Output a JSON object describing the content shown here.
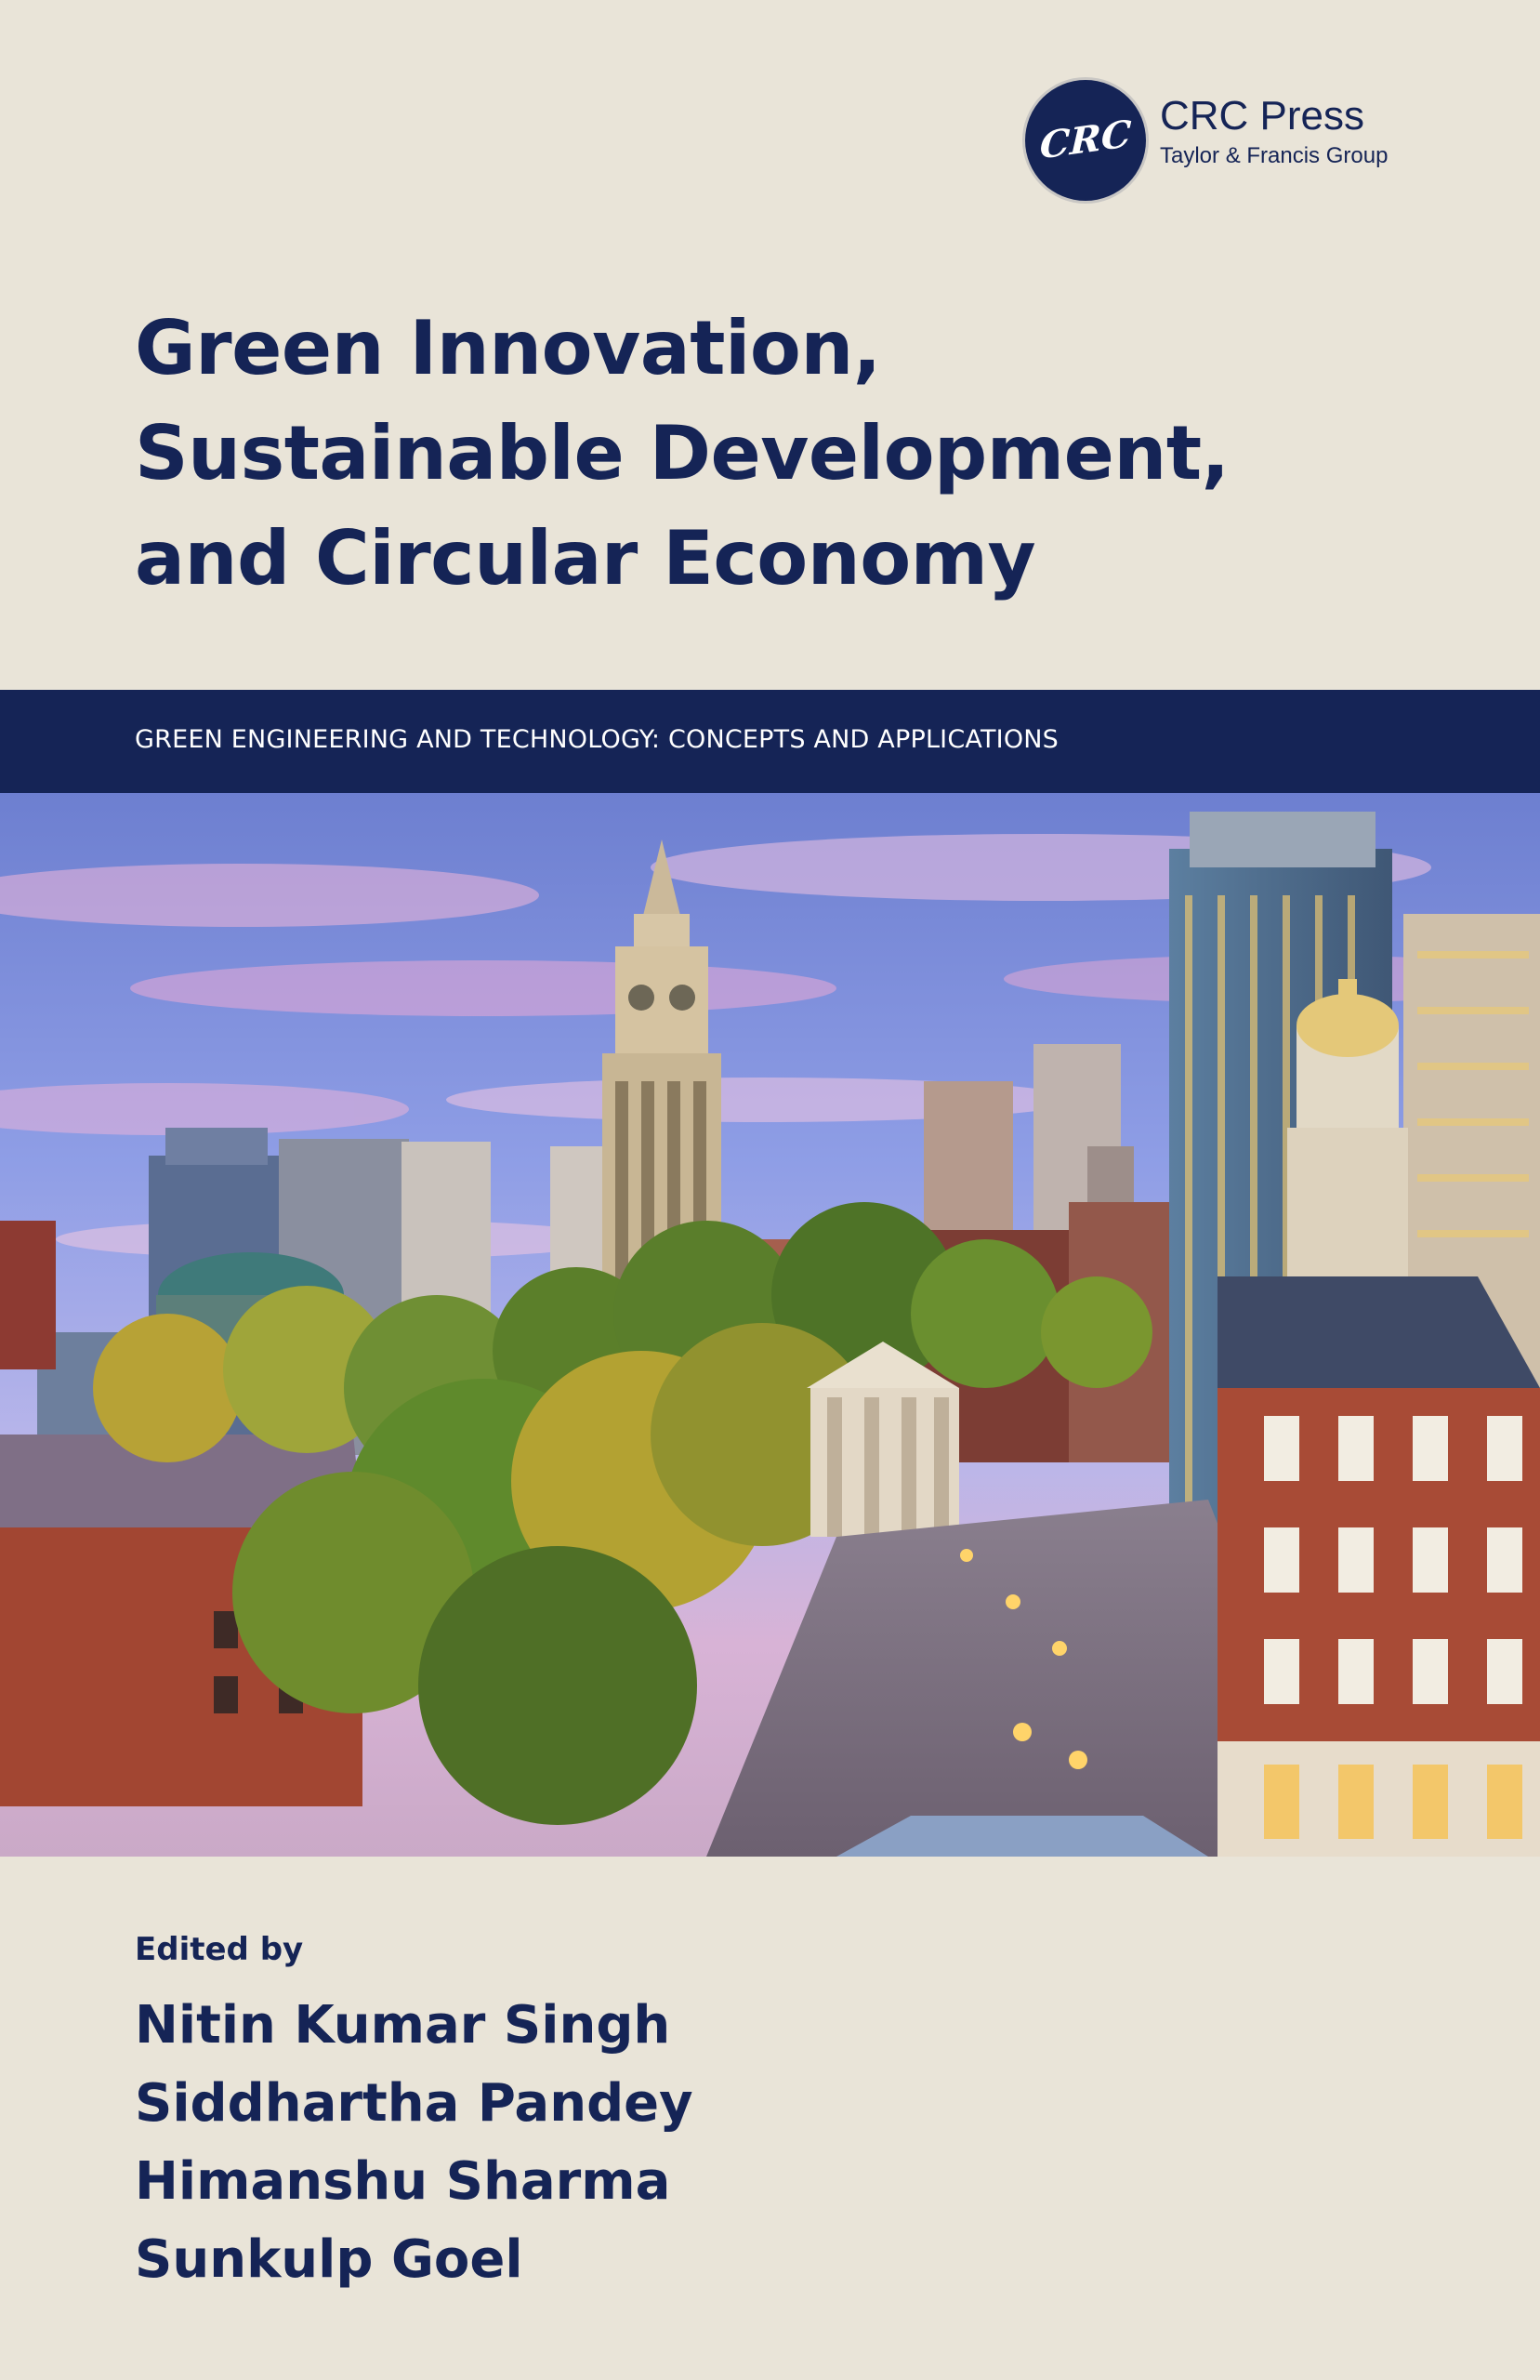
{
  "publisher": {
    "seal_text": "CRC",
    "name": "CRC Press",
    "group": "Taylor & Francis Group"
  },
  "title": {
    "lines": [
      "Green Innovation,",
      "Sustainable Development,",
      "and Circular Economy"
    ]
  },
  "series": {
    "label": "GREEN ENGINEERING AND TECHNOLOGY: CONCEPTS AND APPLICATIONS"
  },
  "editors": {
    "heading": "Edited by",
    "names": [
      "Nitin Kumar Singh",
      "Siddhartha Pandey",
      "Himanshu Sharma",
      "Sunkulp Goel"
    ]
  },
  "colors": {
    "background": "#e9e4d8",
    "brand_navy": "#152456",
    "band_text": "#ffffff"
  },
  "photo": {
    "subject": "city-skyline-photo"
  }
}
